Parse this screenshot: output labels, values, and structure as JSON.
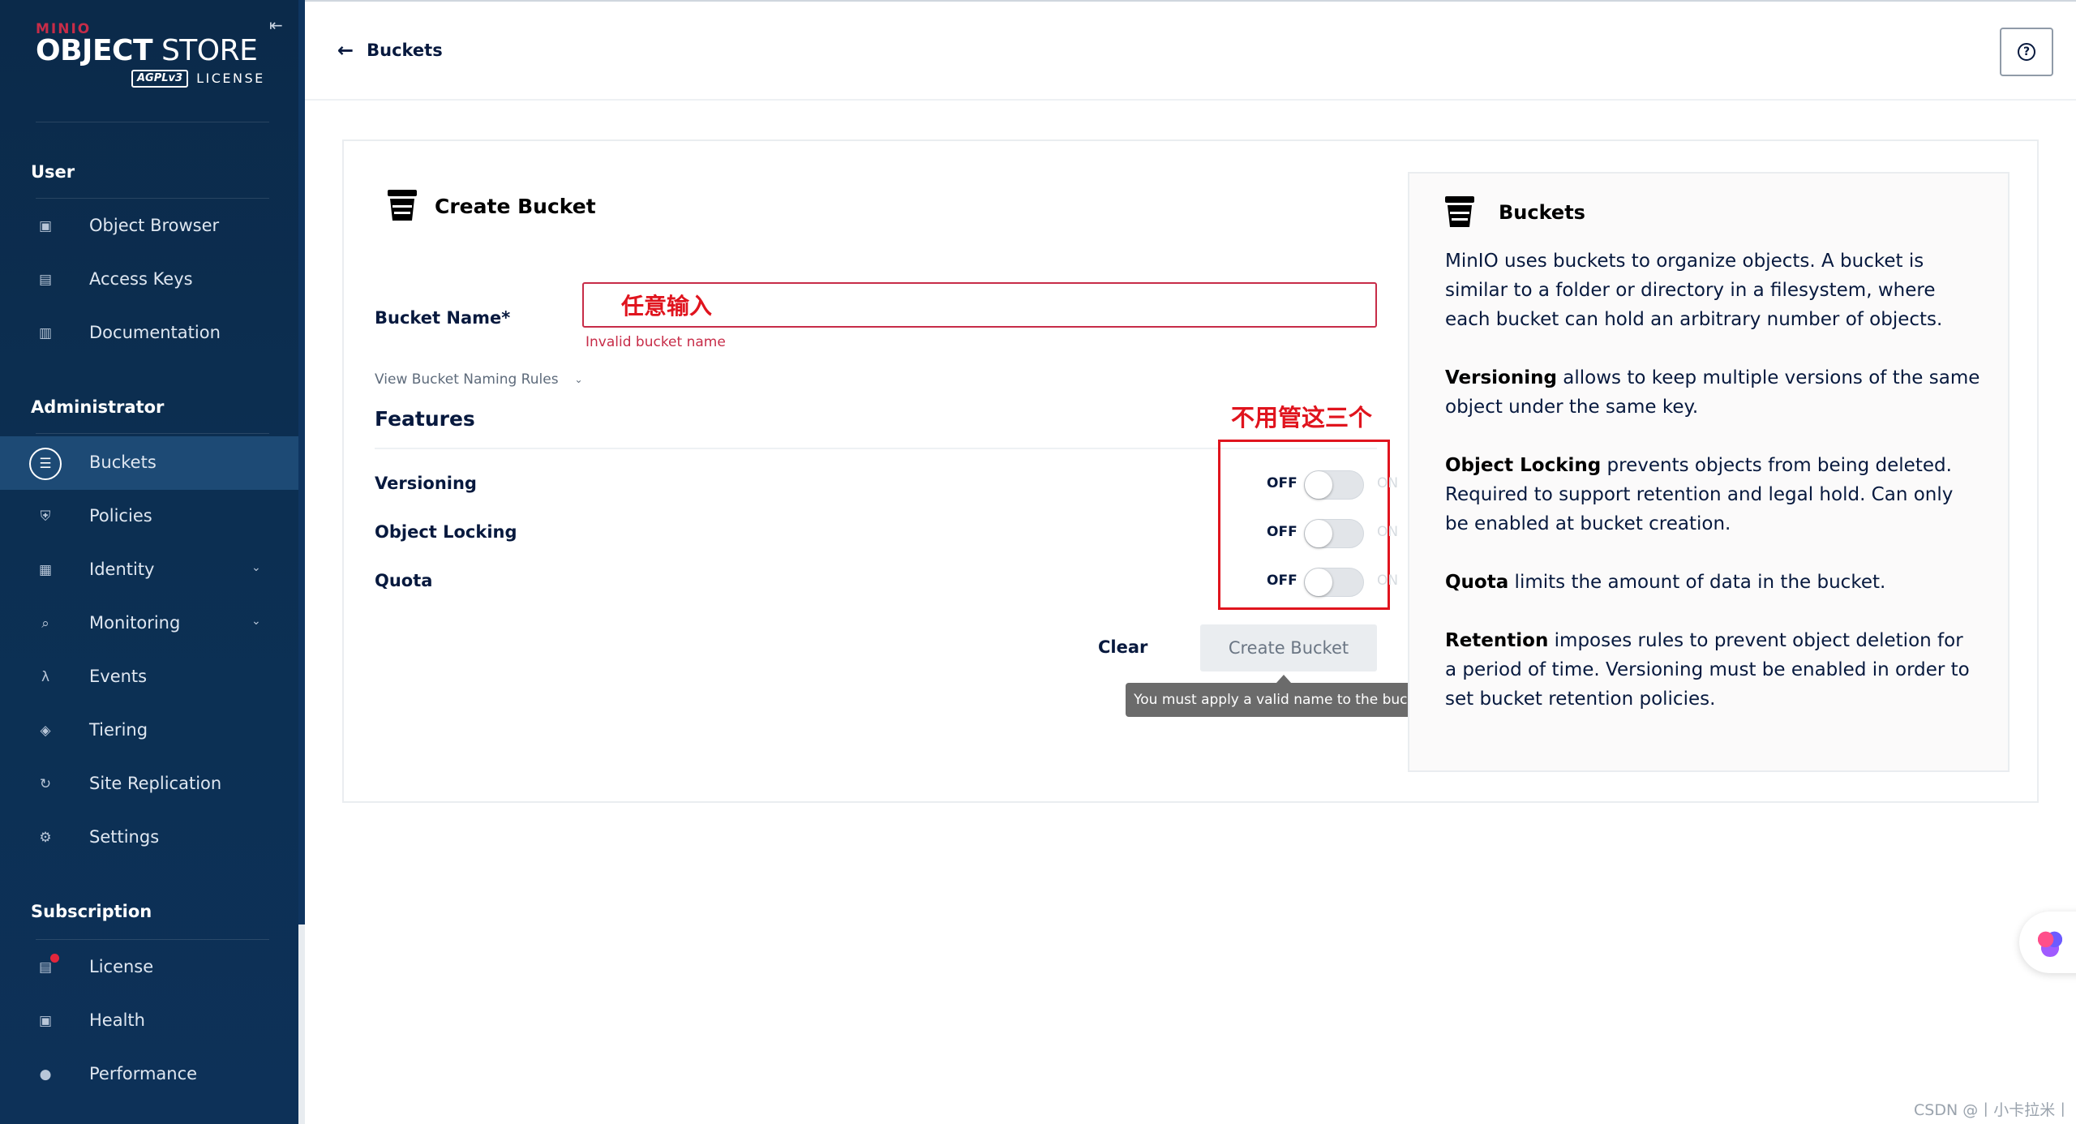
{
  "logo": {
    "brand": "MINIO",
    "product_bold": "OBJECT",
    "product_rest": " STORE",
    "agpl": "AGPLv3",
    "license": "LICENSE"
  },
  "sidebar": {
    "sections": {
      "user": "User",
      "administrator": "Administrator",
      "subscription": "Subscription"
    },
    "user_items": [
      {
        "label": "Object Browser",
        "icon": "object-browser-icon"
      },
      {
        "label": "Access Keys",
        "icon": "access-keys-icon"
      },
      {
        "label": "Documentation",
        "icon": "documentation-icon"
      }
    ],
    "admin_items": [
      {
        "label": "Buckets",
        "icon": "bucket-icon",
        "active": true
      },
      {
        "label": "Policies",
        "icon": "shield-icon"
      },
      {
        "label": "Identity",
        "icon": "identity-icon",
        "expandable": true
      },
      {
        "label": "Monitoring",
        "icon": "monitoring-icon",
        "expandable": true
      },
      {
        "label": "Events",
        "icon": "lambda-icon"
      },
      {
        "label": "Tiering",
        "icon": "layers-icon"
      },
      {
        "label": "Site Replication",
        "icon": "replication-icon"
      },
      {
        "label": "Settings",
        "icon": "gear-icon"
      }
    ],
    "subscription_items": [
      {
        "label": "License",
        "icon": "license-icon",
        "badge": true
      },
      {
        "label": "Health",
        "icon": "health-icon"
      },
      {
        "label": "Performance",
        "icon": "performance-icon"
      }
    ]
  },
  "header": {
    "back_label": "Buckets"
  },
  "form": {
    "title": "Create Bucket",
    "bucket_name_label": "Bucket Name*",
    "bucket_name_value": "任意输入",
    "error": "Invalid bucket name",
    "naming_rules": "View Bucket Naming Rules",
    "features_title": "Features",
    "features": [
      {
        "label": "Versioning",
        "off": "OFF",
        "on": "ON",
        "enabled": false
      },
      {
        "label": "Object Locking",
        "off": "OFF",
        "on": "ON",
        "enabled": false
      },
      {
        "label": "Quota",
        "off": "OFF",
        "on": "ON",
        "enabled": false
      }
    ],
    "annotation": "不用管这三个",
    "clear_label": "Clear",
    "create_label": "Create Bucket",
    "tooltip": "You must apply a valid name to the bucket"
  },
  "help": {
    "title": "Buckets",
    "intro": "MinIO uses buckets to organize objects. A bucket is similar to a folder or directory in a filesystem, where each bucket can hold an arbitrary number of objects.",
    "versioning_term": "Versioning",
    "versioning_text": " allows to keep multiple versions of the same object under the same key.",
    "locking_term": "Object Locking",
    "locking_text": " prevents objects from being deleted. Required to support retention and legal hold. Can only be enabled at bucket creation.",
    "quota_term": "Quota",
    "quota_text": " limits the amount of data in the bucket.",
    "retention_term": "Retention",
    "retention_text": " imposes rules to prevent object deletion for a period of time. Versioning must be enabled in order to set bucket retention policies."
  },
  "watermark": "CSDN @丨小卡拉米丨",
  "colors": {
    "sidebar_bg": "#0c2f52",
    "accent_red": "#c72c48",
    "annotation_red": "#e0141e"
  }
}
